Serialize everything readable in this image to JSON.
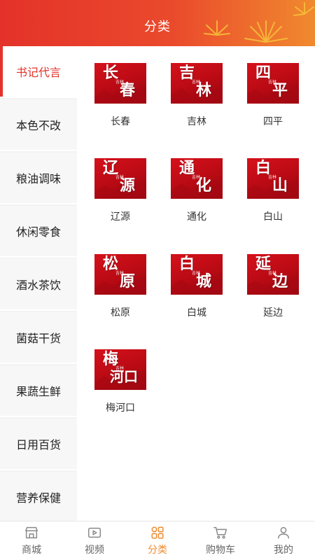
{
  "header": {
    "title": "分类"
  },
  "sidebar": {
    "items": [
      {
        "label": "书记代言",
        "active": true
      },
      {
        "label": "本色不改",
        "active": false
      },
      {
        "label": "粮油调味",
        "active": false
      },
      {
        "label": "休闲零食",
        "active": false
      },
      {
        "label": "酒水茶饮",
        "active": false
      },
      {
        "label": "菌菇干货",
        "active": false
      },
      {
        "label": "果蔬生鲜",
        "active": false
      },
      {
        "label": "日用百货",
        "active": false
      },
      {
        "label": "营养保健",
        "active": false
      }
    ]
  },
  "grid": {
    "items": [
      {
        "label": "长春",
        "art_a": "长",
        "art_b": "春"
      },
      {
        "label": "吉林",
        "art_a": "吉",
        "art_b": "林"
      },
      {
        "label": "四平",
        "art_a": "四",
        "art_b": "平"
      },
      {
        "label": "辽源",
        "art_a": "辽",
        "art_b": "源"
      },
      {
        "label": "通化",
        "art_a": "通",
        "art_b": "化"
      },
      {
        "label": "白山",
        "art_a": "白",
        "art_b": "山"
      },
      {
        "label": "松原",
        "art_a": "松",
        "art_b": "原"
      },
      {
        "label": "白城",
        "art_a": "白",
        "art_b": "城"
      },
      {
        "label": "延边",
        "art_a": "延",
        "art_b": "边"
      },
      {
        "label": "梅河口",
        "art_a": "梅",
        "art_b": "河口"
      }
    ],
    "seal_text": "吉林"
  },
  "bottom_nav": {
    "items": [
      {
        "label": "商城",
        "icon": "store-icon"
      },
      {
        "label": "视频",
        "icon": "video-icon"
      },
      {
        "label": "分类",
        "icon": "category-icon",
        "active": true
      },
      {
        "label": "购物车",
        "icon": "cart-icon"
      },
      {
        "label": "我的",
        "icon": "user-icon"
      }
    ]
  },
  "colors": {
    "accent_red": "#e4322a",
    "accent_orange": "#f08a2e",
    "thumb_red": "#c80d16"
  }
}
